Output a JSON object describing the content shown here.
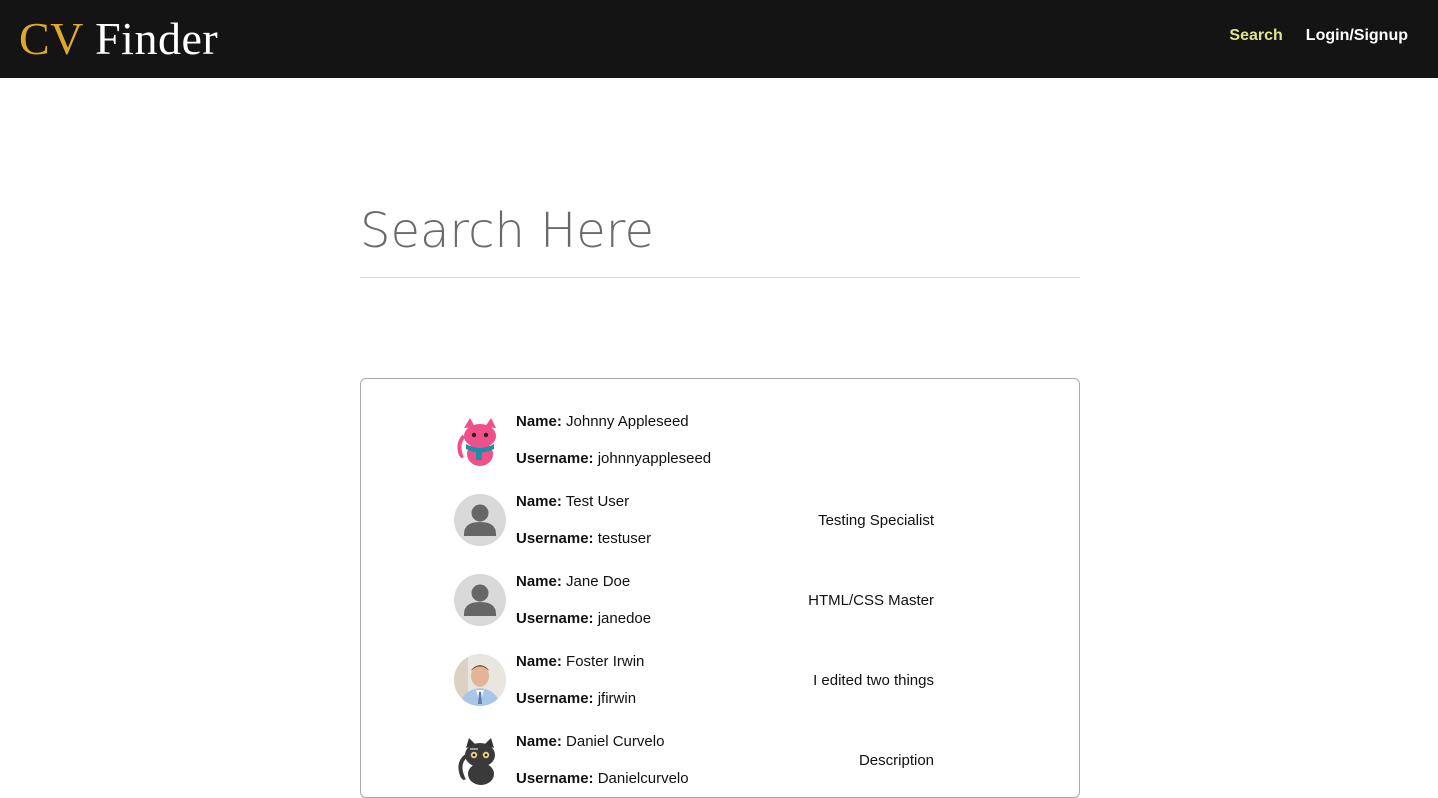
{
  "nav": {
    "brand_cv": "CV",
    "brand_finder": "Finder",
    "links": [
      "Search",
      "Login/Signup"
    ]
  },
  "search": {
    "placeholder": "Search Here"
  },
  "labels": {
    "name": "Name:",
    "username": "Username:"
  },
  "results": [
    {
      "name": "Johnny Appleseed",
      "username": "johnnyappleseed",
      "description": "",
      "avatar": "pink-cat-icon"
    },
    {
      "name": "Test User",
      "username": "testuser",
      "description": "Testing Specialist",
      "avatar": "default-user-icon"
    },
    {
      "name": "Jane Doe",
      "username": "janedoe",
      "description": "HTML/CSS Master",
      "avatar": "default-user-icon"
    },
    {
      "name": "Foster Irwin",
      "username": "jfirwin",
      "description": "I edited two things",
      "avatar": "user-photo"
    },
    {
      "name": "Daniel Curvelo",
      "username": "Danielcurvelo",
      "description": "Description",
      "avatar": "black-cat-icon"
    }
  ],
  "colors": {
    "navbar": "#141414",
    "brand_accent": "#e0a92c",
    "nav_active": "#dfe58a"
  }
}
